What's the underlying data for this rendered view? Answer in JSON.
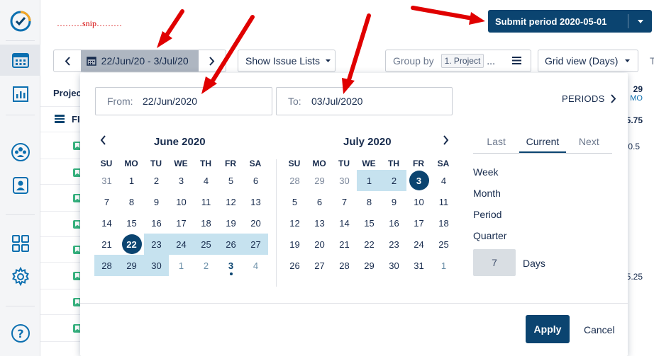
{
  "annotation": {
    "snip_text": "………snip………"
  },
  "header": {
    "submit_label": "Submit period 2020-05-01"
  },
  "toolbar": {
    "range_label": "22/Jun/20 - 3/Jul/20",
    "issue_lists_label": "Show Issue Lists",
    "group_by_label": "Group by",
    "group_chip": "1. Project",
    "group_more": "...",
    "grid_view_label": "Grid view (Days)",
    "edge_text": "T"
  },
  "background": {
    "column_header": "Projec",
    "row_fi": "FI",
    "right_values": [
      "29",
      "MO",
      "5.75",
      "0.5",
      "5.25"
    ]
  },
  "picker": {
    "from_label": "From:",
    "from_value": "22/Jun/2020",
    "to_label": "To:",
    "to_value": "03/Jul/2020",
    "periods_label": "PERIODS",
    "weekdays": [
      "SU",
      "MO",
      "TU",
      "WE",
      "TH",
      "FR",
      "SA"
    ],
    "months": [
      {
        "title": "June 2020",
        "weeks": [
          [
            "31",
            "1",
            "2",
            "3",
            "4",
            "5",
            "6"
          ],
          [
            "7",
            "8",
            "9",
            "10",
            "11",
            "12",
            "13"
          ],
          [
            "14",
            "15",
            "16",
            "17",
            "18",
            "19",
            "20"
          ],
          [
            "21",
            "22",
            "23",
            "24",
            "25",
            "26",
            "27"
          ],
          [
            "28",
            "29",
            "30",
            "1",
            "2",
            "3",
            "4"
          ]
        ]
      },
      {
        "title": "July 2020",
        "weeks": [
          [
            "28",
            "29",
            "30",
            "1",
            "2",
            "3",
            "4"
          ],
          [
            "5",
            "6",
            "7",
            "8",
            "9",
            "10",
            "11"
          ],
          [
            "12",
            "13",
            "14",
            "15",
            "16",
            "17",
            "18"
          ],
          [
            "19",
            "20",
            "21",
            "22",
            "23",
            "24",
            "25"
          ],
          [
            "26",
            "27",
            "28",
            "29",
            "30",
            "31",
            "1"
          ]
        ]
      }
    ],
    "period_tabs": [
      "Last",
      "Current",
      "Next"
    ],
    "active_tab": "Current",
    "period_options": [
      "Week",
      "Month",
      "Period",
      "Quarter"
    ],
    "days_value": "7",
    "days_label": "Days",
    "apply_label": "Apply",
    "cancel_label": "Cancel"
  },
  "colors": {
    "brand": "#0b4470",
    "range_fill": "#c6e2ef",
    "annotation_arrow": "#e00000"
  },
  "icons": [
    "logo-check-icon",
    "calendar-icon",
    "report-icon",
    "team-icon",
    "user-card-icon",
    "apps-grid-icon",
    "gear-icon",
    "help-icon"
  ]
}
